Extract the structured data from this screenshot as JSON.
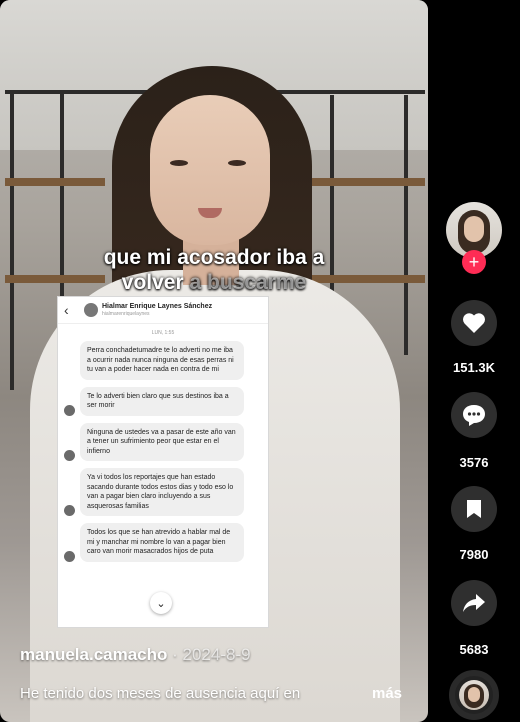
{
  "video": {
    "caption_line1": "que mi acosador iba a",
    "caption_line2_strong": "volver",
    "caption_line2_dim": " a buscarme"
  },
  "chat": {
    "name": "Hialmar Enrique Laynes Sánchez",
    "handle": "hialmarenriquelaynes",
    "date": "LUN, 1:55",
    "messages": [
      {
        "text": "Perra conchadetumadre te lo adverti no me iba a ocurrir nada nunca ninguna de esas perras ni tu van a poder hacer nada en contra de mi",
        "avatar": false
      },
      {
        "text": "Te lo adverti bien claro que sus destinos iba a ser morir",
        "avatar": true
      },
      {
        "text": "Ninguna de ustedes va a pasar de este año van a tener un sufrimiento peor que estar en el infierno",
        "avatar": true
      },
      {
        "text": "Ya vi todos los reportajes que han estado sacando durante todos estos dias y todo eso lo van a pagar bien claro incluyendo a sus asquerosas familias",
        "avatar": true
      },
      {
        "text": "Todos los que se han atrevido a hablar mal de mi y manchar mi nombre lo van a pagar bien caro van morir masacrados hijos de puta",
        "avatar": true
      }
    ]
  },
  "post": {
    "username": "manuela.camacho",
    "date": " · 2024-8-9",
    "description": "He tenido dos meses de ausencia aquí en",
    "more_label": "más"
  },
  "actions": {
    "likes": "151.3K",
    "comments": "3576",
    "saves": "7980",
    "shares": "5683",
    "follow_symbol": "+"
  },
  "colors": {
    "follow": "#fe2c55",
    "rail_button": "#2f2f2f"
  }
}
